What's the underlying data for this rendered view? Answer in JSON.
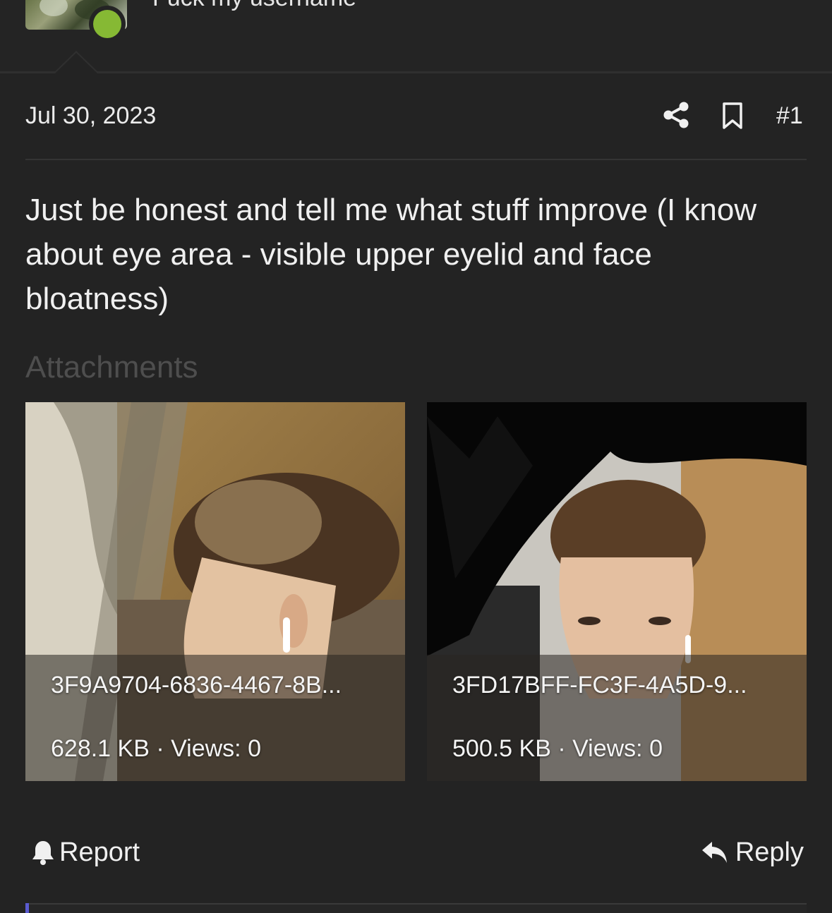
{
  "user": {
    "username": "Fuck my username",
    "status": "online"
  },
  "post": {
    "date": "Jul 30, 2023",
    "number": "#1",
    "body": "Just be honest and tell me what stuff improve (I know about eye area - visible upper eyelid and face bloatness)"
  },
  "attachments": {
    "heading": "Attachments",
    "items": [
      {
        "name": "3F9A9704-6836-4467-8B...",
        "meta": "628.1 KB · Views: 0"
      },
      {
        "name": "3FD17BFF-FC3F-4A5D-9...",
        "meta": "500.5 KB · Views: 0"
      }
    ]
  },
  "actions": {
    "report_label": "Report",
    "reply_label": "Reply"
  },
  "icons": {
    "share": "share-icon",
    "bookmark": "bookmark-icon",
    "report": "bell-icon",
    "reply": "reply-arrow-icon"
  },
  "colors": {
    "background": "#232323",
    "online": "#86b934",
    "muted_heading": "#4e4e4e",
    "accent": "#5a5bd0"
  }
}
